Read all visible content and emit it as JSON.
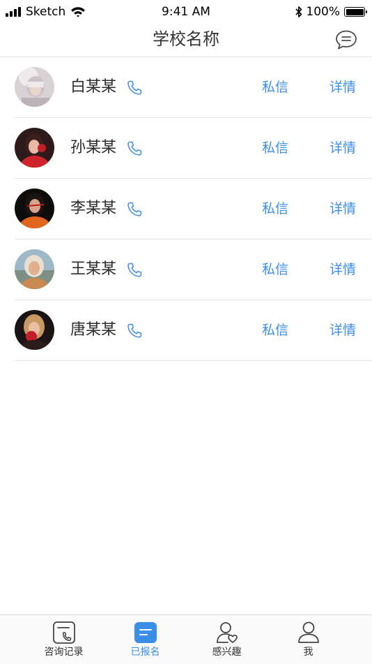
{
  "status_bar": {
    "carrier": "Sketch",
    "time": "9:41 AM",
    "battery": "100%",
    "battery_level": 1.0
  },
  "header": {
    "title": "学校名称",
    "message_icon": "chat-bubble-icon"
  },
  "contacts": [
    {
      "name": "白某某",
      "message_label": "私信",
      "detail_label": "详情",
      "phone_icon": "phone-icon"
    },
    {
      "name": "孙某某",
      "message_label": "私信",
      "detail_label": "详情",
      "phone_icon": "phone-icon"
    },
    {
      "name": "李某某",
      "message_label": "私信",
      "detail_label": "详情",
      "phone_icon": "phone-icon"
    },
    {
      "name": "王某某",
      "message_label": "私信",
      "detail_label": "详情",
      "phone_icon": "phone-icon"
    },
    {
      "name": "唐某某",
      "message_label": "私信",
      "detail_label": "详情",
      "phone_icon": "phone-icon"
    }
  ],
  "tab_bar": {
    "tabs": [
      {
        "label": "咨询记录",
        "icon": "consult-record-icon",
        "active": false
      },
      {
        "label": "已报名",
        "icon": "registered-icon",
        "active": true
      },
      {
        "label": "感兴趣",
        "icon": "interested-icon",
        "active": false
      },
      {
        "label": "我",
        "icon": "user-icon",
        "active": false
      }
    ]
  },
  "colors": {
    "accent": "#3b8ee8",
    "text": "#2b2b2b",
    "divider": "#e6e6e6"
  }
}
